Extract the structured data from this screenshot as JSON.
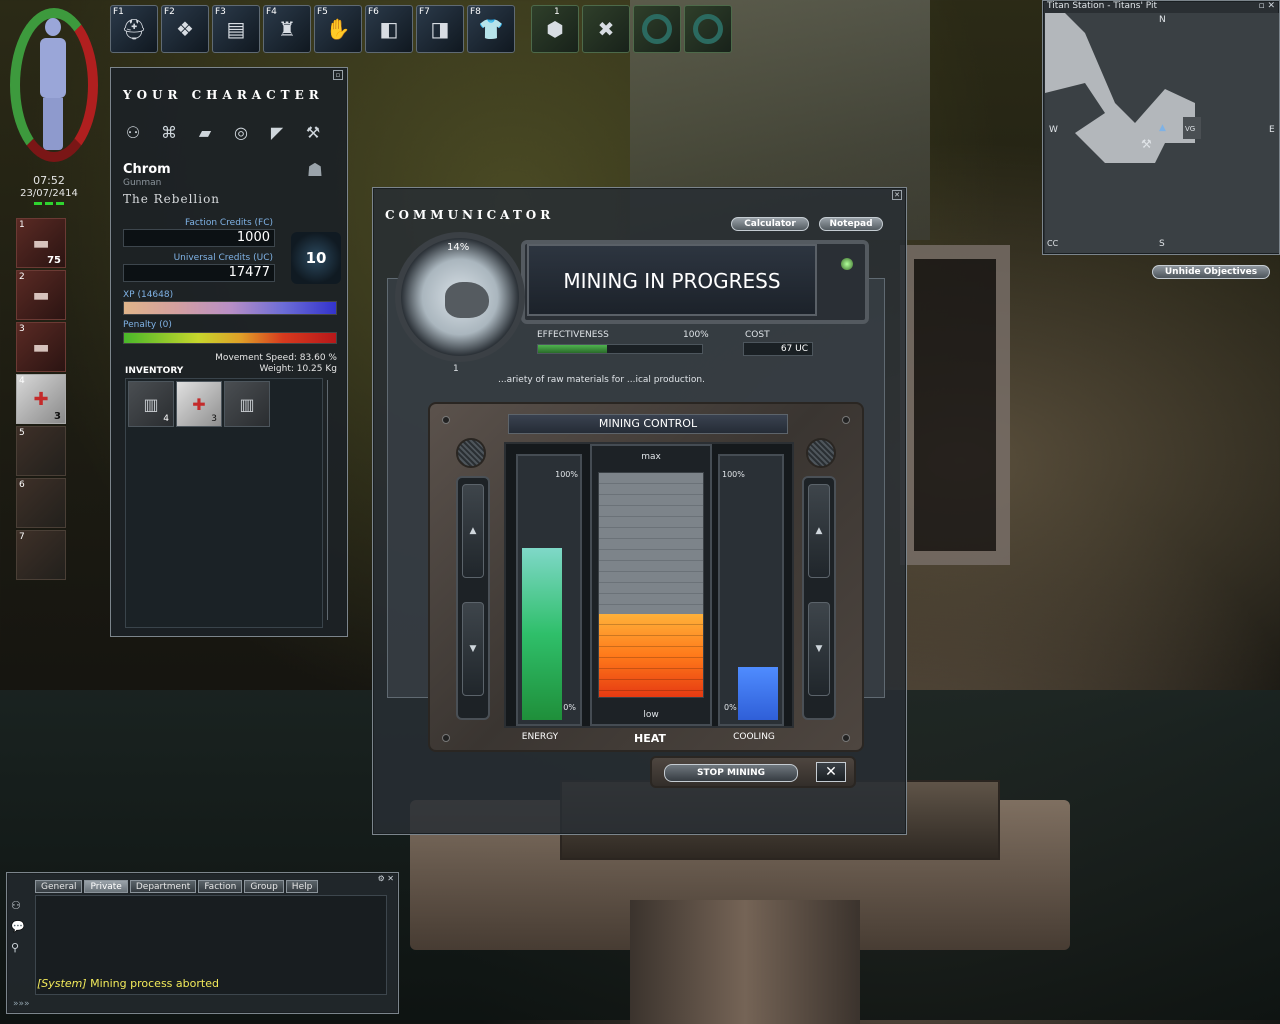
{
  "status": {
    "time": "07:52",
    "date": "23/07/2414"
  },
  "hotbar": [
    {
      "key": "F1",
      "icon": "helmet-icon"
    },
    {
      "key": "F2",
      "icon": "vest-icon"
    },
    {
      "key": "F3",
      "icon": "armor-icon"
    },
    {
      "key": "F4",
      "icon": "heavy-armor-icon"
    },
    {
      "key": "F5",
      "icon": "gloves-icon"
    },
    {
      "key": "F6",
      "icon": "arm-guard-icon"
    },
    {
      "key": "F7",
      "icon": "leg-guard-icon"
    },
    {
      "key": "F8",
      "icon": "shirt-icon"
    }
  ],
  "action_slot_count": "1",
  "quickslots": [
    {
      "num": "1",
      "count": "75",
      "icon": "rifle-icon"
    },
    {
      "num": "2",
      "count": "",
      "icon": "rifle-icon"
    },
    {
      "num": "3",
      "count": "",
      "icon": "rifle-icon"
    },
    {
      "num": "4",
      "count": "3",
      "icon": "medkit-icon"
    },
    {
      "num": "5",
      "count": "",
      "icon": "empty-slot-icon"
    },
    {
      "num": "6",
      "count": "",
      "icon": "empty-slot-icon"
    },
    {
      "num": "7",
      "count": "",
      "icon": "empty-slot-icon"
    }
  ],
  "character": {
    "title": "YOUR CHARACTER",
    "name": "Chrom",
    "class": "Gunman",
    "faction": "The Rebellion",
    "fc_label": "Faction Credits (FC)",
    "fc_value": "1000",
    "uc_label": "Universal Credits (UC)",
    "uc_value": "17477",
    "level": "10",
    "xp_label": "XP (14648)",
    "penalty_label": "Penalty (0)",
    "movement": "Movement Speed: 83.60 %",
    "weight": "Weight: 10.25 Kg",
    "inventory_title": "INVENTORY",
    "inventory": [
      {
        "count": "4",
        "icon": "armor-plate-icon"
      },
      {
        "count": "3",
        "icon": "medkit-icon"
      },
      {
        "count": "",
        "icon": "armor-plate-icon"
      }
    ]
  },
  "minimap": {
    "title": "Titan Station - Titans' Pit",
    "north": "N",
    "south": "S",
    "west": "W",
    "east": "E",
    "marker": "VG",
    "corner_label": "CC"
  },
  "unhide_objectives": "Unhide Objectives",
  "communicator": {
    "title": "COMMUNICATOR",
    "calculator": "Calculator",
    "notepad": "Notepad",
    "description": "...ariety of raw materials for ...ical production."
  },
  "mining": {
    "progress_pct": "14%",
    "count": "1",
    "headline": "MINING IN PROGRESS",
    "effectiveness_label": "EFFECTIVENESS",
    "effectiveness_pct": "100%",
    "effectiveness_fraction": 0.42,
    "cost_label": "COST",
    "cost_value": "67 UC"
  },
  "mining_control": {
    "title": "MINING CONTROL",
    "energy_label": "ENERGY",
    "heat_label": "HEAT",
    "cooling_label": "COOLING",
    "max": "max",
    "low": "low",
    "scale_top": "100%",
    "scale_bottom": "0%",
    "energy_level": 0.66,
    "heat_level": 0.37,
    "cooling_level": 0.22,
    "stop": "STOP MINING",
    "close": "✕",
    "up": "▲",
    "down": "▼"
  },
  "chat": {
    "tabs": [
      "General",
      "Private",
      "Department",
      "Faction",
      "Group",
      "Help"
    ],
    "active_tab": "Private",
    "system_tag": "[System]",
    "message": "Mining process aborted",
    "more": "»»»"
  },
  "colors": {
    "energy": "#2fbf6a",
    "cooling": "#2f5fd8"
  }
}
